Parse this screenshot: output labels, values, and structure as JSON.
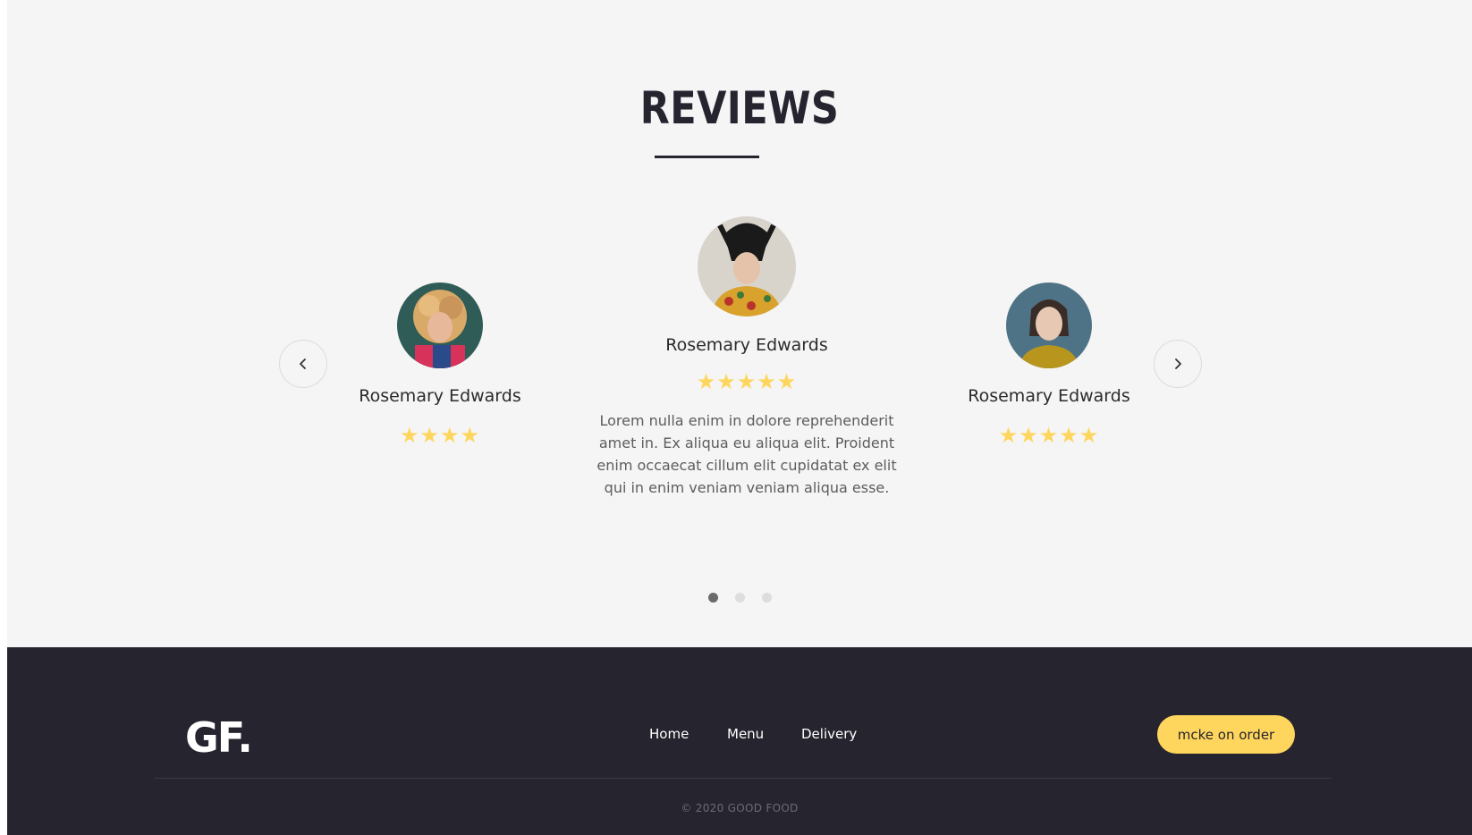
{
  "reviews": {
    "title": "REVIEWS",
    "items": [
      {
        "name": "Rosemary Edwards",
        "rating": 4,
        "stars": "★★★★"
      },
      {
        "name": "Rosemary Edwards",
        "rating": 5,
        "stars": "★★★★★",
        "text": "Lorem nulla enim in dolore reprehenderit amet in. Ex aliqua eu aliqua elit. Proident enim occaecat cillum elit cupidatat ex elit qui in enim veniam veniam aliqua esse."
      },
      {
        "name": "Rosemary Edwards",
        "rating": 5,
        "stars": "★★★★★"
      }
    ],
    "prev_icon": "chevron-left-icon",
    "next_icon": "chevron-right-icon",
    "pagination": {
      "count": 3,
      "active": 1
    }
  },
  "footer": {
    "logo": "GF.",
    "nav": [
      "Home",
      "Menu",
      "Delivery"
    ],
    "cta_label": "mcke on order",
    "copyright": "© 2020 GOOD FOOD"
  },
  "colors": {
    "accent": "#fed65d",
    "dark": "#26242f",
    "background": "#f5f5f5"
  }
}
